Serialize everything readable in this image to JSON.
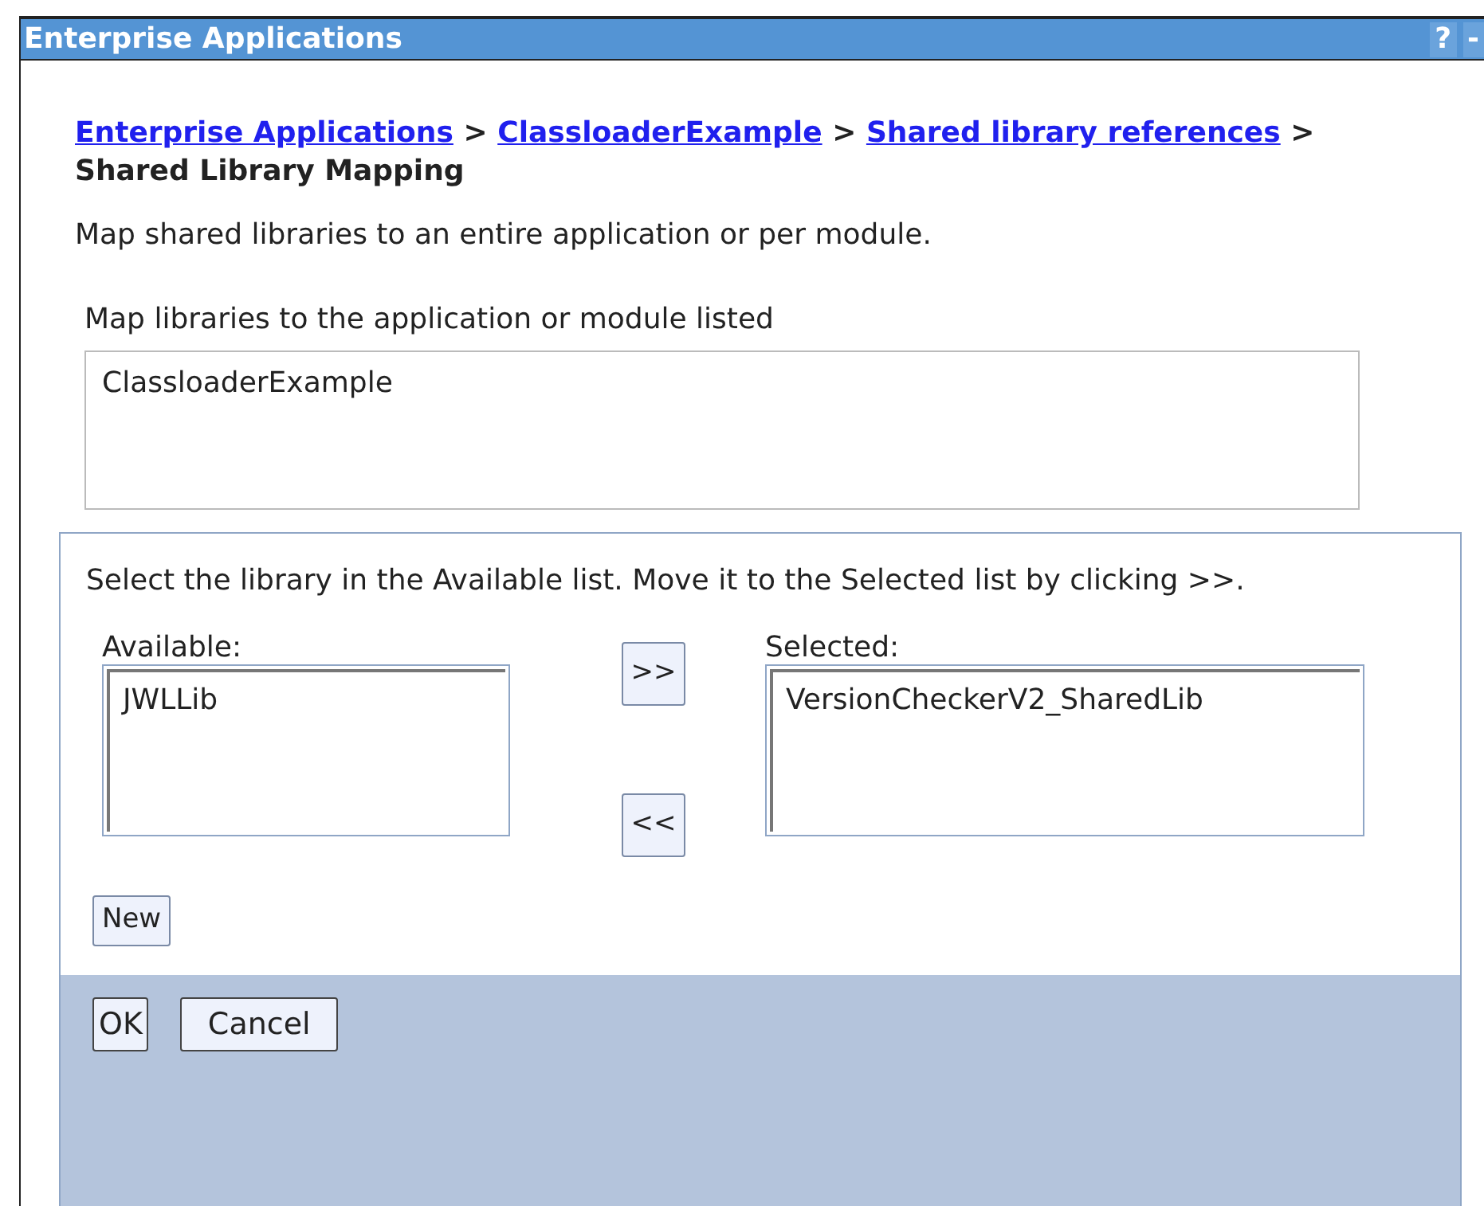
{
  "window": {
    "title": "Enterprise Applications",
    "controls": [
      "?",
      "-"
    ]
  },
  "breadcrumb": {
    "links": [
      "Enterprise Applications",
      "ClassloaderExample",
      "Shared library references"
    ],
    "separator": ">",
    "current": "Shared Library Mapping"
  },
  "description": "Map shared libraries to an entire application or per module.",
  "target": {
    "label": "Map libraries to the application or module listed",
    "items": [
      "ClassloaderExample"
    ]
  },
  "mapping": {
    "instructions": "Select the library in the Available list. Move it to the Selected list by clicking >>.",
    "available": {
      "label": "Available:",
      "items": [
        "JWLLib"
      ]
    },
    "add_button": ">>",
    "remove_button": "<<",
    "selected": {
      "label": "Selected:",
      "items": [
        "VersionCheckerV2_SharedLib"
      ]
    },
    "new_button": "New"
  },
  "buttons": [
    "OK",
    "Cancel"
  ]
}
